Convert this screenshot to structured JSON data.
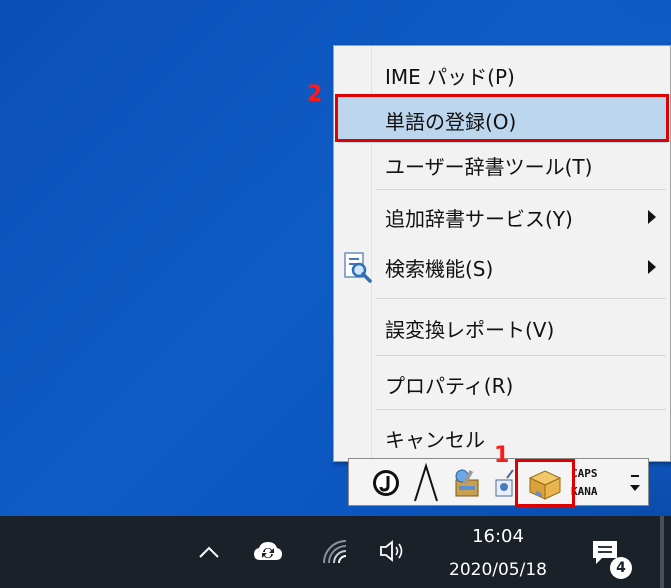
{
  "menu": {
    "items": [
      {
        "label": "IME パッド(P)",
        "highlighted": false,
        "submenu": false
      },
      {
        "label": "単語の登録(O)",
        "highlighted": true,
        "submenu": false
      },
      {
        "label": "ユーザー辞書ツール(T)",
        "highlighted": false,
        "submenu": false
      },
      {
        "label": "追加辞書サービス(Y)",
        "highlighted": false,
        "submenu": true
      },
      {
        "label": "検索機能(S)",
        "highlighted": false,
        "submenu": true
      },
      {
        "label": "誤変換レポート(V)",
        "highlighted": false,
        "submenu": false
      },
      {
        "label": "プロパティ(R)",
        "highlighted": false,
        "submenu": false
      },
      {
        "label": "キャンセル",
        "highlighted": false,
        "submenu": false
      }
    ]
  },
  "annotations": {
    "step1": "1",
    "step2": "2",
    "color": "#e00000"
  },
  "imebar": {
    "caps": "CAPS",
    "kana": "KANA",
    "buttons": [
      "ime-mode-icon",
      "handwriting-icon",
      "tools-icon",
      "dictionary-icon",
      "toolbox-icon"
    ]
  },
  "taskbar": {
    "time": "16:04",
    "date": "2020/05/18",
    "notification_count": "4",
    "tray_icons": [
      "chevron-up-icon",
      "cloud-sync-icon",
      "wifi-icon",
      "speaker-icon",
      "notification-icon"
    ]
  },
  "colors": {
    "desktop": "#0f5cc4",
    "menu_bg": "#f2f2f2",
    "highlight": "#bcd6ee",
    "taskbar": "#1b2129"
  }
}
